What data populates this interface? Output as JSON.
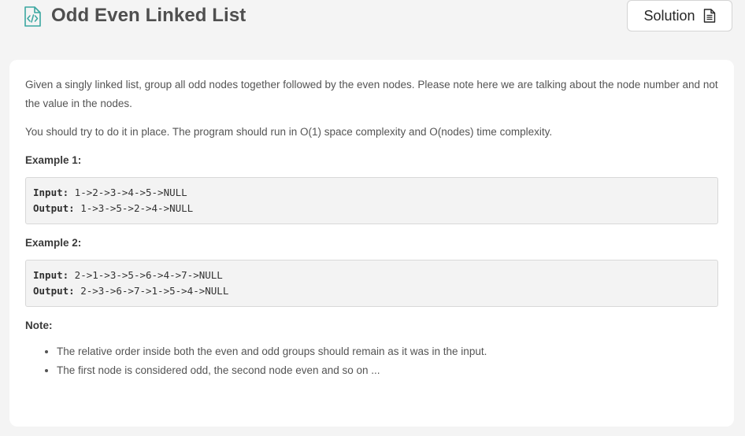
{
  "header": {
    "title": "Odd Even Linked List",
    "solution_label": "Solution",
    "accent_color": "#3aa6a0"
  },
  "description": {
    "paragraph_1": "Given a singly linked list, group all odd nodes together followed by the even nodes. Please note here we are talking about the node number and not the value in the nodes.",
    "paragraph_2": "You should try to do it in place. The program should run in O(1) space complexity and O(nodes) time complexity."
  },
  "examples": [
    {
      "heading": "Example 1:",
      "input_label": "Input:",
      "input_value": " 1->2->3->4->5->NULL",
      "output_label": "Output:",
      "output_value": " 1->3->5->2->4->NULL"
    },
    {
      "heading": "Example 2:",
      "input_label": "Input:",
      "input_value": " 2->1->3->5->6->4->7->NULL",
      "output_label": "Output:",
      "output_value": " 2->3->6->7->1->5->4->NULL"
    }
  ],
  "note": {
    "heading": "Note:",
    "items": [
      "The relative order inside both the even and odd groups should remain as it was in the input.",
      "The first node is considered odd, the second node even and so on ..."
    ]
  },
  "icons": {
    "title_icon": "code-file-icon",
    "solution_icon": "document-icon"
  }
}
